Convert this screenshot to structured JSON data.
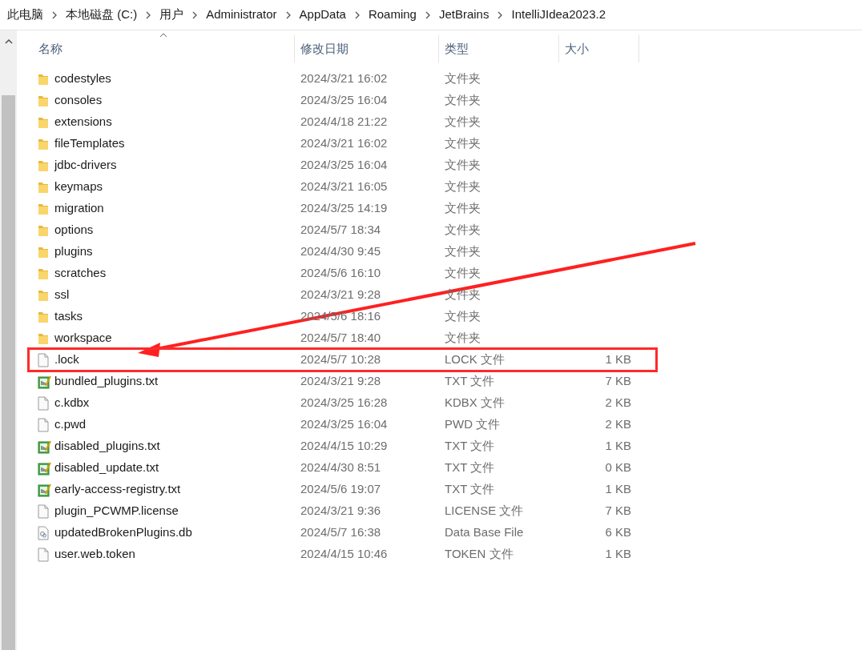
{
  "breadcrumb": [
    "此电脑",
    "本地磁盘 (C:)",
    "用户",
    "Administrator",
    "AppData",
    "Roaming",
    "JetBrains",
    "IntelliJIdea2023.2"
  ],
  "columns": [
    "名称",
    "修改日期",
    "类型",
    "大小"
  ],
  "rows": [
    {
      "kind": "folder",
      "name": "codestyles",
      "date": "2024/3/21 16:02",
      "type": "文件夹",
      "annotated": false
    },
    {
      "kind": "folder",
      "name": "consoles",
      "date": "2024/3/25 16:04",
      "type": "文件夹",
      "annotated": false
    },
    {
      "kind": "folder",
      "name": "extensions",
      "date": "2024/4/18 21:22",
      "type": "文件夹",
      "annotated": false
    },
    {
      "kind": "folder",
      "name": "fileTemplates",
      "date": "2024/3/21 16:02",
      "type": "文件夹",
      "annotated": false
    },
    {
      "kind": "folder",
      "name": "jdbc-drivers",
      "date": "2024/3/25 16:04",
      "type": "文件夹",
      "annotated": false
    },
    {
      "kind": "folder",
      "name": "keymaps",
      "date": "2024/3/21 16:05",
      "type": "文件夹",
      "annotated": false
    },
    {
      "kind": "folder",
      "name": "migration",
      "date": "2024/3/25 14:19",
      "type": "文件夹",
      "annotated": false
    },
    {
      "kind": "folder",
      "name": "options",
      "date": "2024/5/7 18:34",
      "type": "文件夹",
      "annotated": false
    },
    {
      "kind": "folder",
      "name": "plugins",
      "date": "2024/4/30 9:45",
      "type": "文件夹",
      "annotated": false
    },
    {
      "kind": "folder",
      "name": "scratches",
      "date": "2024/5/6 16:10",
      "type": "文件夹",
      "annotated": false
    },
    {
      "kind": "folder",
      "name": "ssl",
      "date": "2024/3/21 9:28",
      "type": "文件夹",
      "annotated": false
    },
    {
      "kind": "folder",
      "name": "tasks",
      "date": "2024/5/6 18:16",
      "type": "文件夹",
      "annotated": false
    },
    {
      "kind": "folder",
      "name": "workspace",
      "date": "2024/5/7 18:40",
      "type": "文件夹",
      "annotated": false
    },
    {
      "kind": "file",
      "name": ".lock",
      "date": "2024/5/7 10:28",
      "type": "LOCK 文件",
      "size": "1 KB",
      "annotated": true
    },
    {
      "kind": "text",
      "name": "bundled_plugins.txt",
      "date": "2024/3/21 9:28",
      "type": "TXT 文件",
      "size": "7 KB",
      "annotated": false
    },
    {
      "kind": "file",
      "name": "c.kdbx",
      "date": "2024/3/25 16:28",
      "type": "KDBX 文件",
      "size": "2 KB",
      "annotated": false
    },
    {
      "kind": "file",
      "name": "c.pwd",
      "date": "2024/3/25 16:04",
      "type": "PWD 文件",
      "size": "2 KB",
      "annotated": false
    },
    {
      "kind": "text",
      "name": "disabled_plugins.txt",
      "date": "2024/4/15 10:29",
      "type": "TXT 文件",
      "size": "1 KB",
      "annotated": false
    },
    {
      "kind": "text",
      "name": "disabled_update.txt",
      "date": "2024/4/30 8:51",
      "type": "TXT 文件",
      "size": "0 KB",
      "annotated": false
    },
    {
      "kind": "text",
      "name": "early-access-registry.txt",
      "date": "2024/5/6 19:07",
      "type": "TXT 文件",
      "size": "1 KB",
      "annotated": false
    },
    {
      "kind": "file",
      "name": "plugin_PCWMP.license",
      "date": "2024/3/21 9:36",
      "type": "LICENSE 文件",
      "size": "7 KB",
      "annotated": false
    },
    {
      "kind": "db",
      "name": "updatedBrokenPlugins.db",
      "date": "2024/5/7 16:38",
      "type": "Data Base File",
      "size": "6 KB",
      "annotated": false
    },
    {
      "kind": "file",
      "name": "user.web.token",
      "date": "2024/4/15 10:46",
      "type": "TOKEN 文件",
      "size": "1 KB",
      "annotated": false
    }
  ]
}
